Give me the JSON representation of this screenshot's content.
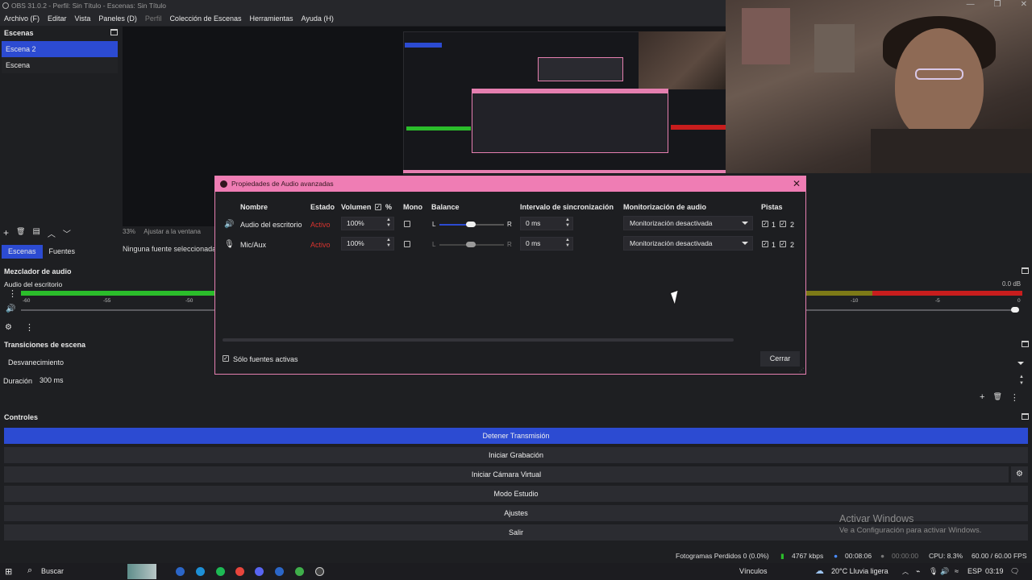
{
  "window": {
    "title": "OBS 31.0.2 - Perfil: Sin Título - Escenas: Sin Título",
    "controls": [
      "—",
      "❐",
      "✕"
    ]
  },
  "menu": {
    "items": [
      "Archivo (F)",
      "Editar",
      "Vista",
      "Paneles (D)",
      "Perfil",
      "Colección de Escenas",
      "Herramientas",
      "Ayuda (H)"
    ]
  },
  "scenes": {
    "title": "Escenas",
    "items": [
      "Escena 2",
      "Escena"
    ],
    "toolbar": [
      "+",
      "🗑",
      "▤",
      "︿",
      "﹀"
    ]
  },
  "preview": {
    "zoom": "33%",
    "fit": "Ajustar a la ventana",
    "no_source": "Ninguna fuente seleccionada"
  },
  "tabs": {
    "scenes": "Escenas",
    "sources": "Fuentes"
  },
  "mixer": {
    "title": "Mezclador de audio",
    "track_name": "Audio del escritorio",
    "db_readout": "0.0 dB",
    "ticks_left": [
      "-60",
      "-55",
      "-50"
    ],
    "ticks_right": [
      "-10",
      "-5",
      "0"
    ]
  },
  "transitions": {
    "title": "Transiciones de escena",
    "selected": "Desvanecimiento",
    "duration_label": "Duración",
    "duration_value": "300 ms"
  },
  "controls": {
    "title": "Controles",
    "buttons": [
      "Detener Transmisión",
      "Iniciar Grabación",
      "Iniciar Cámara Virtual",
      "Modo Estudio",
      "Ajustes",
      "Salir"
    ]
  },
  "watermark": {
    "line1": "Activar Windows",
    "line2": "Ve a Configuración para activar Windows."
  },
  "status": {
    "dropped": "Fotogramas Perdidos 0 (0.0%)",
    "kbps": "4767 kbps",
    "stream_time": "00:08:06",
    "rec_time": "00:00:00",
    "cpu": "CPU: 8.3%",
    "fps": "60.00 / 60.00 FPS"
  },
  "taskbar": {
    "search": "Buscar",
    "links": "Vínculos",
    "weather": "20°C  Lluvia ligera",
    "lang": "ESP",
    "time": "03:19"
  },
  "dialog": {
    "title": "Propiedades de Audio avanzadas",
    "headers": {
      "name": "Nombre",
      "status": "Estado",
      "volume": "Volumen",
      "percent": "%",
      "mono": "Mono",
      "balance": "Balance",
      "sync": "Intervalo de sincronización",
      "monitoring": "Monitorización de audio",
      "tracks": "Pistas"
    },
    "rows": [
      {
        "name": "Audio del escritorio",
        "status": "Activo",
        "volume": "100%",
        "balance_l": "L",
        "balance_r": "R",
        "balance": 0.5,
        "sync": "0 ms",
        "monitoring": "Monitorización desactivada",
        "track1": "1",
        "track2": "2"
      },
      {
        "name": "Mic/Aux",
        "status": "Activo",
        "volume": "100%",
        "balance_l": "L",
        "balance_r": "R",
        "balance": 0.5,
        "sync": "0 ms",
        "monitoring": "Monitorización desactivada",
        "track1": "1",
        "track2": "2"
      }
    ],
    "only_active": "Sólo fuentes activas",
    "close": "Cerrar"
  },
  "colors": {
    "accent": "#2c4bd2",
    "dialog_title": "#ef7db4",
    "status_active": "#d8342f",
    "meter_green": "#2bbd2b",
    "meter_red": "#c81d1d"
  }
}
